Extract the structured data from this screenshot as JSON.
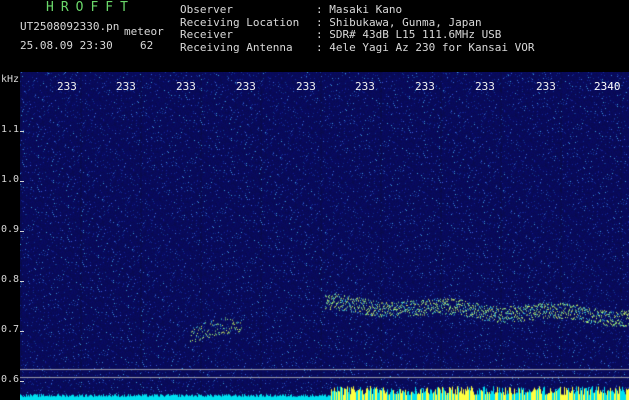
{
  "header": {
    "logo": "HROFFT",
    "file_name": "UT2508092330.pn",
    "meteor_label": "meteor",
    "timestamp": "25.08.09 23:30",
    "count": "62",
    "info": [
      {
        "key": "Observer",
        "value": ": Masaki Kano"
      },
      {
        "key": "Receiving Location",
        "value": ": Shibukawa, Gunma, Japan"
      },
      {
        "key": "Receiver",
        "value": ": SDR# 43dB L15 111.6MHz USB"
      },
      {
        "key": "Receiving Antenna",
        "value": ": 4ele Yagi Az 230 for Kansai VOR"
      }
    ]
  },
  "spectrogram": {
    "y_unit": "kHz",
    "y_ticks": [
      "1.1",
      "1.0",
      "0.9",
      "0.8",
      "0.7",
      "0.6"
    ],
    "x_ticks": [
      "233",
      "233",
      "233",
      "233",
      "233",
      "233",
      "233",
      "233",
      "233",
      "2340"
    ],
    "colors": {
      "background": "#0a0c56",
      "signal": "#9cff80",
      "power_bar": "#00e0f0",
      "power_peak": "#ffff40"
    }
  }
}
